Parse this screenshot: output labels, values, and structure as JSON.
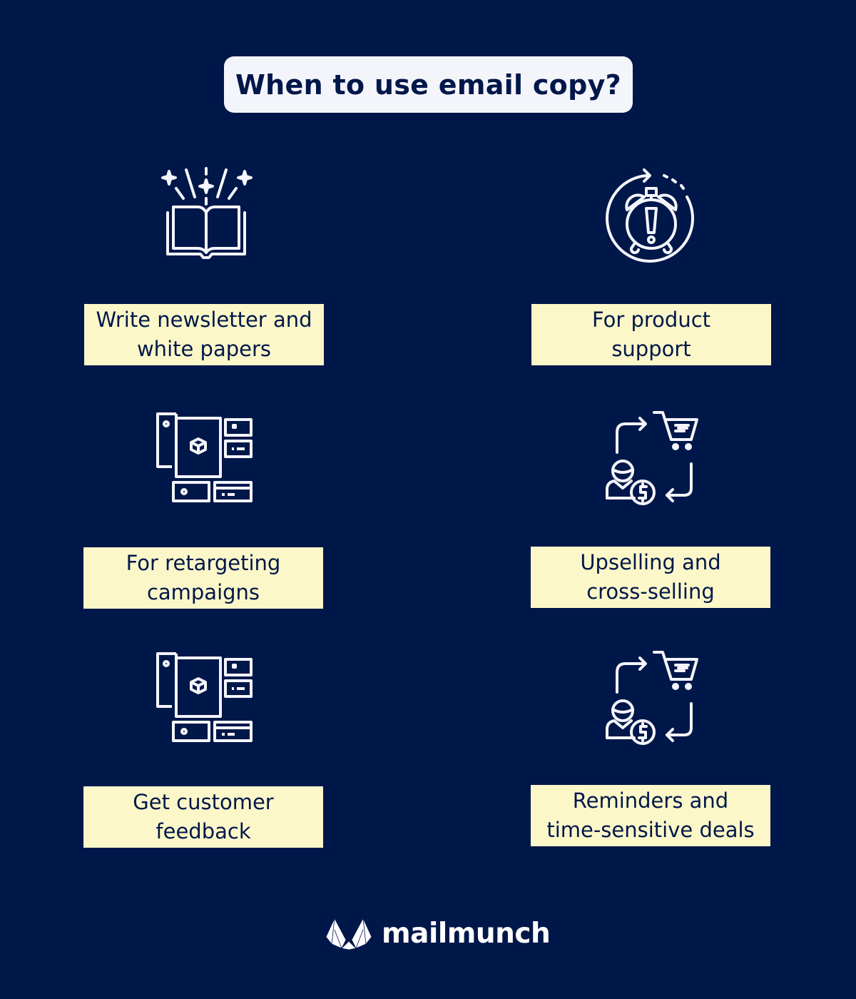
{
  "title": "When to use email copy?",
  "colors": {
    "background": "#00174a",
    "title_box": "#f4f5fb",
    "label_box": "#fbf7c8",
    "text_dark": "#00174a",
    "icon_stroke": "#f4f5fb"
  },
  "items": [
    {
      "icon": "open-book-sparkles-icon",
      "label": "Write newsletter and\nwhite papers"
    },
    {
      "icon": "alarm-clock-icon",
      "label": "For product\nsupport"
    },
    {
      "icon": "product-layout-icon",
      "label": "For retargeting\ncampaigns"
    },
    {
      "icon": "customer-cart-cycle-icon",
      "label": "Upselling and\ncross-selling"
    },
    {
      "icon": "product-layout-icon",
      "label": "Get customer\nfeedback"
    },
    {
      "icon": "customer-cart-cycle-icon",
      "label": "Reminders and\ntime-sensitive deals"
    }
  ],
  "brand": {
    "name": "mailmunch",
    "icon": "mailmunch-logo-icon"
  }
}
